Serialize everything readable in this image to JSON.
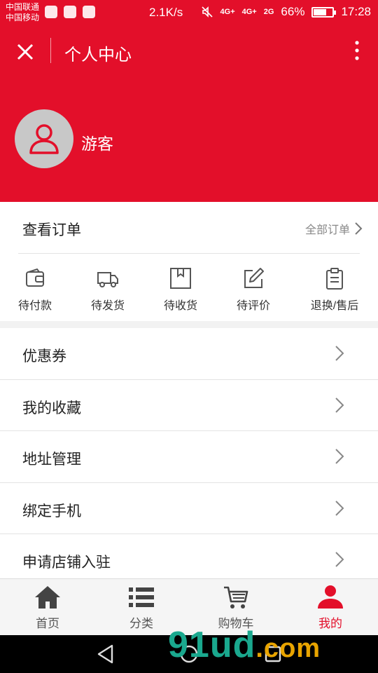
{
  "status_bar": {
    "carrier_1": "中国联通",
    "carrier_2": "中国移动",
    "speed": "2.1K/s",
    "network_1": "4G+",
    "network_2": "4G+",
    "network_3": "2G",
    "battery_percent": "66%",
    "battery_level": 0.66,
    "time": "17:28"
  },
  "header": {
    "title": "个人中心",
    "username": "游客",
    "bg_color": "#e30f2a"
  },
  "orders": {
    "heading": "查看订单",
    "all_link": "全部订单",
    "tabs": [
      {
        "label": "待付款",
        "icon": "wallet-icon"
      },
      {
        "label": "待发货",
        "icon": "truck-icon"
      },
      {
        "label": "待收货",
        "icon": "box-icon"
      },
      {
        "label": "待评价",
        "icon": "edit-icon"
      },
      {
        "label": "退换/售后",
        "icon": "clipboard-icon"
      }
    ]
  },
  "menu": {
    "items": [
      {
        "label": "优惠券"
      },
      {
        "label": "我的收藏"
      },
      {
        "label": "地址管理"
      },
      {
        "label": "绑定手机"
      },
      {
        "label": "申请店铺入驻"
      }
    ]
  },
  "tabbar": {
    "items": [
      {
        "label": "首页",
        "icon": "home-icon"
      },
      {
        "label": "分类",
        "icon": "list-icon"
      },
      {
        "label": "购物车",
        "icon": "cart-icon"
      },
      {
        "label": "我的",
        "icon": "user-icon",
        "active": true
      }
    ],
    "active_color": "#e30f2a"
  },
  "watermark": {
    "text_a": "91",
    "text_b": "ud",
    "text_c": ".com"
  }
}
